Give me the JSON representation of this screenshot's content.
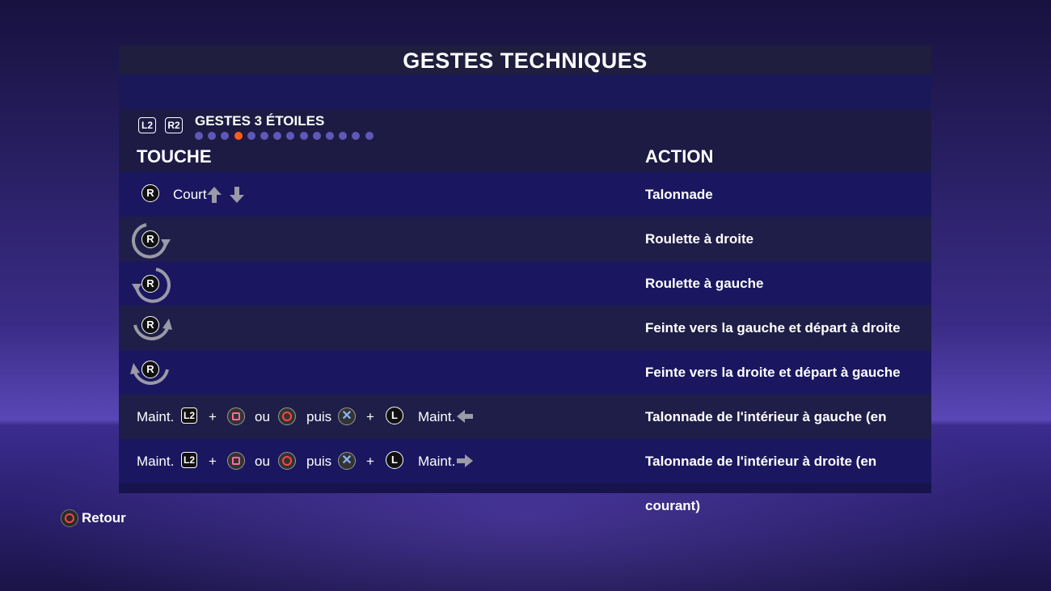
{
  "screen": {
    "title": "GESTES TECHNIQUES",
    "tab": {
      "left_trigger": "L2",
      "right_trigger": "R2",
      "label": "GESTES 3 ÉTOILES",
      "page_count": 14,
      "active_page": 4
    },
    "columns": {
      "control": "TOUCHE",
      "action": "ACTION"
    },
    "rows": [
      {
        "action": "Talonnade",
        "control_text": "Court"
      },
      {
        "action": "Roulette à droite"
      },
      {
        "action": "Roulette à gauche"
      },
      {
        "action": "Feinte vers la gauche et départ à droite"
      },
      {
        "action": "Feinte vers la droite et départ à gauche"
      },
      {
        "action": "Talonnade de l'intérieur à gauche (en courant)",
        "hold_1": "Maint.",
        "or_word": "ou",
        "then_word": "puis",
        "plus": "+",
        "hold_2": "Maint."
      },
      {
        "action": "Talonnade de l'intérieur à droite (en courant)",
        "hold_1": "Maint.",
        "or_word": "ou",
        "then_word": "puis",
        "plus": "+",
        "hold_2": "Maint."
      }
    ],
    "button_labels": {
      "r_stick": "R",
      "l_stick": "L",
      "l2": "L2"
    },
    "footer": {
      "back_label": "Retour"
    },
    "colors": {
      "accent": "#ff5a1f",
      "circle": "#ff4545",
      "panel": "#17144d"
    }
  }
}
